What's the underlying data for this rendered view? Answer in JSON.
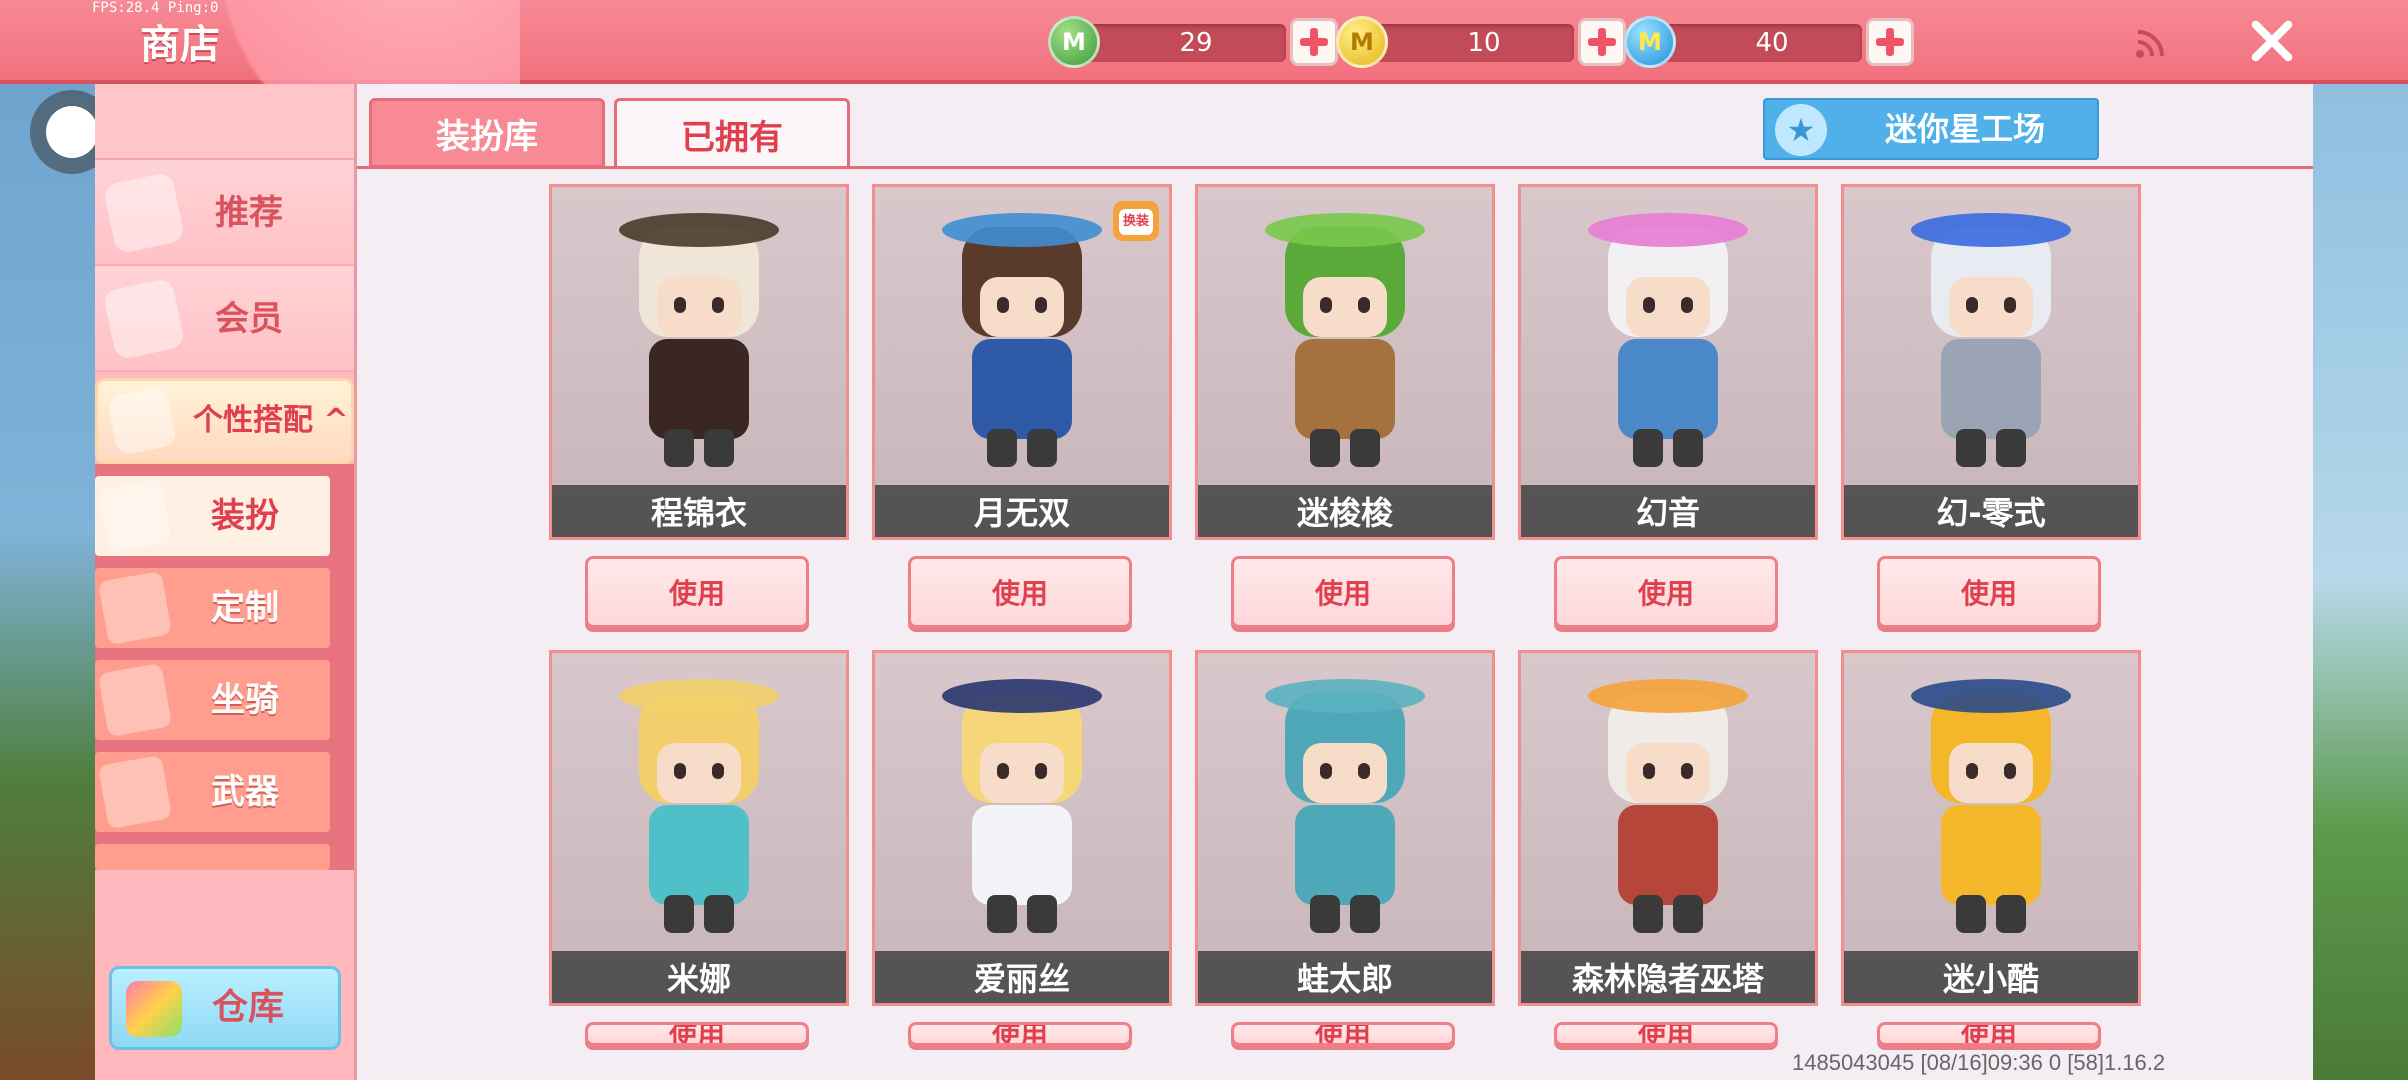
{
  "fps_text": "FPS:28.4  Ping:0",
  "header": {
    "title": "商店",
    "currencies": [
      {
        "name": "mini-bean",
        "value": "29",
        "icon": "green-coin-icon",
        "color": "#3e9a3a"
      },
      {
        "name": "mini-coin",
        "value": "10",
        "icon": "gold-coin-icon",
        "color": "#e5b417"
      },
      {
        "name": "mini-point",
        "value": "40",
        "icon": "blue-coin-icon",
        "color": "#1f8fd8"
      }
    ],
    "coin_letter": "M"
  },
  "sidebar": {
    "items": [
      {
        "label": "推荐",
        "icon": "thumbs-up-icon"
      },
      {
        "label": "会员",
        "icon": "vip-card-icon"
      },
      {
        "label": "个性搭配",
        "icon": "outfit-icon",
        "expanded": true
      }
    ],
    "sub_items": [
      {
        "label": "装扮",
        "icon": "shirt-icon",
        "active": true
      },
      {
        "label": "定制",
        "icon": "pencil-icon"
      },
      {
        "label": "坐骑",
        "icon": "mount-icon"
      },
      {
        "label": "武器",
        "icon": "gun-icon"
      }
    ],
    "warehouse_label": "仓库"
  },
  "tabs": {
    "library": "装扮库",
    "owned": "已拥有"
  },
  "workshop": {
    "label": "迷你星工场",
    "icon": "star-icon"
  },
  "skins": [
    {
      "name": "程锦衣",
      "button": "使用",
      "hair": "#f0e6d8",
      "hat": "#4a3a2a",
      "body": "#3a2622"
    },
    {
      "name": "月无双",
      "button": "使用",
      "hair": "#5a3a2a",
      "hat": "#3f8ed0",
      "body": "#2f5aa8",
      "tag": "换装"
    },
    {
      "name": "迷梭梭",
      "button": "使用",
      "hair": "#5aaa3a",
      "hat": "#79c84c",
      "body": "#a5713e"
    },
    {
      "name": "幻音",
      "button": "使用",
      "hair": "#f2f0f2",
      "hat": "#e87bd4",
      "body": "#4a88c8"
    },
    {
      "name": "幻-零式",
      "button": "使用",
      "hair": "#e8ecf2",
      "hat": "#3a6ae0",
      "body": "#9aa4b4"
    },
    {
      "name": "米娜",
      "button": "使用",
      "hair": "#f2cf6a",
      "hat": "#f2cf6a",
      "body": "#4fc0c8"
    },
    {
      "name": "爱丽丝",
      "button": "使用",
      "hair": "#f5d77a",
      "hat": "#2a3570",
      "body": "#f4f4f8"
    },
    {
      "name": "蛙太郎",
      "button": "使用",
      "hair": "#4fa8b8",
      "hat": "#5ab0c0",
      "body": "#4fa8b8"
    },
    {
      "name": "森林隐者巫塔",
      "button": "使用",
      "hair": "#f0ebe6",
      "hat": "#f4a23a",
      "body": "#b6453a"
    },
    {
      "name": "迷小酷",
      "button": "使用",
      "hair": "#f5b72a",
      "hat": "#2a4a8a",
      "body": "#f5b72a"
    }
  ],
  "footer": "1485043045   [08/16]09:36 0  [58]1.16.2"
}
